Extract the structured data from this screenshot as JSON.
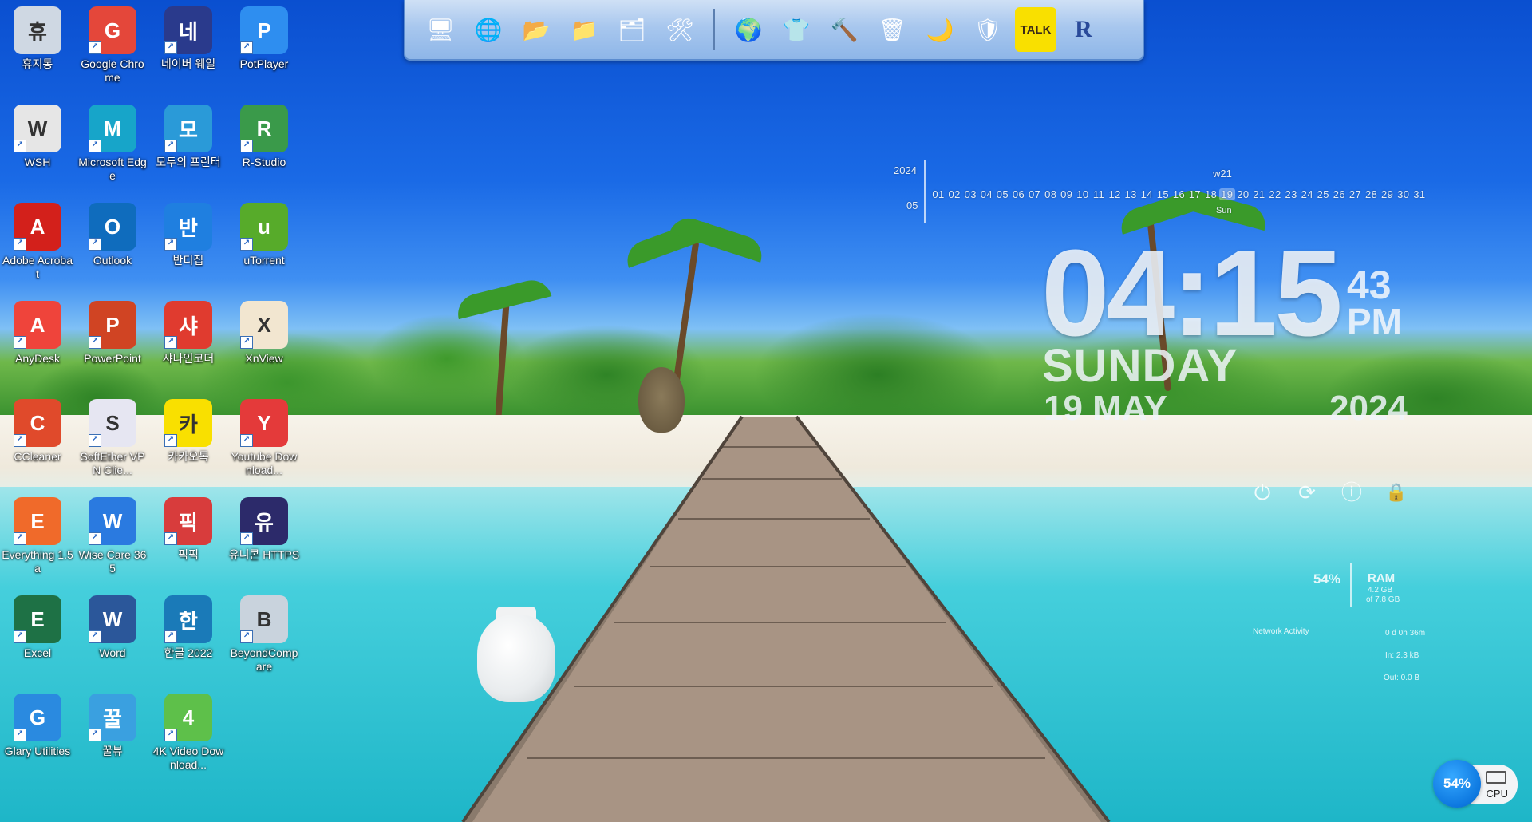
{
  "desktop": {
    "icons": [
      {
        "label": "휴지통",
        "icon": "recycle-bin-icon",
        "color": "#cfd8e3"
      },
      {
        "label": "Google Chrome",
        "icon": "chrome-icon",
        "color": "#e4473a"
      },
      {
        "label": "네이버 웨일",
        "icon": "whale-browser-icon",
        "color": "#2a3a8c"
      },
      {
        "label": "PotPlayer",
        "icon": "potplayer-icon",
        "color": "#2e8ef0"
      },
      {
        "label": "WSH",
        "icon": "file-icon",
        "color": "#e6e6e6"
      },
      {
        "label": "Microsoft Edge",
        "icon": "edge-icon",
        "color": "#17a5c9"
      },
      {
        "label": "모두의 프린터",
        "icon": "printer-icon",
        "color": "#2a9ad8"
      },
      {
        "label": "R-Studio",
        "icon": "r-studio-icon",
        "color": "#3a9a4a"
      },
      {
        "label": "Adobe Acrobat",
        "icon": "acrobat-icon",
        "color": "#d3201b"
      },
      {
        "label": "Outlook",
        "icon": "outlook-icon",
        "color": "#0f6cbd"
      },
      {
        "label": "반디집",
        "icon": "bandizip-icon",
        "color": "#1f7fe0"
      },
      {
        "label": "uTorrent",
        "icon": "utorrent-icon",
        "color": "#57ab2a"
      },
      {
        "label": "AnyDesk",
        "icon": "anydesk-icon",
        "color": "#ef443b"
      },
      {
        "label": "PowerPoint",
        "icon": "powerpoint-icon",
        "color": "#d04423"
      },
      {
        "label": "샤나인코더",
        "icon": "shana-encoder-icon",
        "color": "#e03b2f"
      },
      {
        "label": "XnView",
        "icon": "xnview-icon",
        "color": "#f2e6d0"
      },
      {
        "label": "CCleaner",
        "icon": "ccleaner-icon",
        "color": "#e04a2b"
      },
      {
        "label": "SoftEther VPN Clie...",
        "icon": "softether-icon",
        "color": "#e6e6f2"
      },
      {
        "label": "카카오톡",
        "icon": "kakaotalk-icon",
        "color": "#f9e000"
      },
      {
        "label": "Youtube Download...",
        "icon": "youtube-downloader-icon",
        "color": "#e43a3a"
      },
      {
        "label": "Everything 1.5a",
        "icon": "everything-search-icon",
        "color": "#f06a2a"
      },
      {
        "label": "Wise Care 365",
        "icon": "wise-care-icon",
        "color": "#2a7ae0"
      },
      {
        "label": "픽픽",
        "icon": "picpick-icon",
        "color": "#d83c3c"
      },
      {
        "label": "유니콘 HTTPS",
        "icon": "unicorn-https-icon",
        "color": "#2c2a6a"
      },
      {
        "label": "Excel",
        "icon": "excel-icon",
        "color": "#1e7145"
      },
      {
        "label": "Word",
        "icon": "word-icon",
        "color": "#2b579a"
      },
      {
        "label": "한글 2022",
        "icon": "hwp-icon",
        "color": "#1a7ab8"
      },
      {
        "label": "BeyondCompare",
        "icon": "beyond-compare-icon",
        "color": "#c9d3dd"
      },
      {
        "label": "Glary Utilities",
        "icon": "glary-utilities-icon",
        "color": "#2a8ae0"
      },
      {
        "label": "꿀뷰",
        "icon": "honeyview-icon",
        "color": "#3aa0e0"
      },
      {
        "label": "4K Video Download...",
        "icon": "4k-video-downloader-icon",
        "color": "#5ec04a"
      }
    ]
  },
  "toolbar": {
    "left_group": [
      {
        "icon": "monitor-icon",
        "glyph": "🖥"
      },
      {
        "icon": "network-globe-icon",
        "glyph": "🌐"
      },
      {
        "icon": "folder-icon",
        "glyph": "📂"
      },
      {
        "icon": "folder-green-icon",
        "glyph": "📁"
      },
      {
        "icon": "folder-settings-icon",
        "glyph": "🗂"
      },
      {
        "icon": "tools-icon",
        "glyph": "🛠"
      }
    ],
    "right_group": [
      {
        "icon": "globe-icon",
        "glyph": "🌍"
      },
      {
        "icon": "tshirt-icon",
        "glyph": "👕"
      },
      {
        "icon": "hammer-icon",
        "glyph": "🔨"
      },
      {
        "icon": "trash-icon",
        "glyph": "🗑"
      },
      {
        "icon": "glary-icon",
        "glyph": "🌙"
      },
      {
        "icon": "wise-icon",
        "glyph": "🛡"
      },
      {
        "icon": "kakaotalk-talk-icon",
        "glyph": "TALK"
      },
      {
        "icon": "r-studio-tool-icon",
        "glyph": "R"
      }
    ]
  },
  "calendar": {
    "year": "2024",
    "month": "05",
    "week": "w21",
    "day_of_week": "Sun",
    "days": [
      "01",
      "02",
      "03",
      "04",
      "05",
      "06",
      "07",
      "08",
      "09",
      "10",
      "11",
      "12",
      "13",
      "14",
      "15",
      "16",
      "17",
      "18",
      "19",
      "20",
      "21",
      "22",
      "23",
      "24",
      "25",
      "26",
      "27",
      "28",
      "29",
      "30",
      "31"
    ],
    "today": "19"
  },
  "clock": {
    "time": "04:15",
    "seconds": "43",
    "ampm": "PM",
    "weekday": "SUNDAY",
    "date": "19 MAY",
    "year": "2024"
  },
  "power_buttons": [
    {
      "icon": "power-icon",
      "glyph": "⏻"
    },
    {
      "icon": "restart-icon",
      "glyph": "⟳"
    },
    {
      "icon": "info-icon",
      "glyph": "ⓘ"
    },
    {
      "icon": "lock-icon",
      "glyph": "🔒"
    }
  ],
  "system_monitor": {
    "ram_percent": "54%",
    "ram_label": "RAM",
    "ram_used": "4.2 GB",
    "ram_total": "of 7.8 GB",
    "network_label": "Network Activity",
    "network_up": "0 d 0h 36m",
    "network_in": "In: 2.3 kB",
    "network_out": "Out: 0.0 B"
  },
  "cpu_widget": {
    "percent": "54%",
    "label": "CPU"
  },
  "colors": {
    "toolbar_bg": "#a8c7ee",
    "sky": "#1a6ae6",
    "water": "#2ec3d3"
  }
}
